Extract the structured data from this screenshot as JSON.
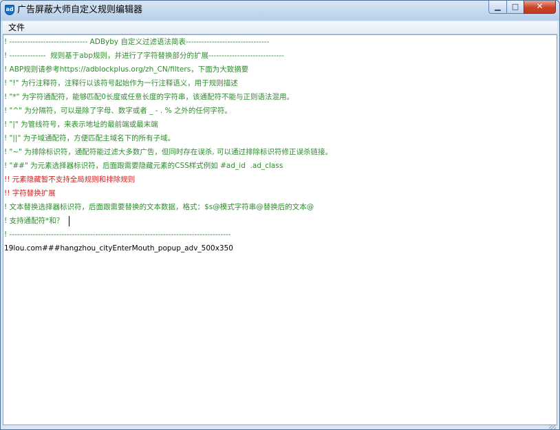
{
  "window": {
    "title": "广告屏蔽大师自定义规则编辑器",
    "icon_label": "ad"
  },
  "caption_buttons": {
    "minimize": "▁",
    "maximize": "□",
    "close": "✕"
  },
  "menu": {
    "file": "文件"
  },
  "editor": {
    "lines": [
      "! ------------------------------ ADByby 自定义过滤语法简表--------------------------------",
      "! --------------  规则基于abp规则，并进行了字符替换部分的扩展-----------------------------",
      "! ABP规则请参考https://adblockplus.org/zh_CN/filters，下面为大致摘要",
      "! \"!\" 为行注释符，注释行以该符号起始作为一行注释语义，用于规则描述",
      "! \"*\" 为字符通配符，能够匹配0长度或任意长度的字符串，该通配符不能与正则语法混用。",
      "! \"^\" 为分隔符，可以是除了字母、数字或者 _ - . % 之外的任何字符。",
      "! \"|\" 为管线符号，来表示地址的最前端或最末端",
      "! \"||\" 为子域通配符，方便匹配主域名下的所有子域。",
      "! \"~\" 为排除标识符，通配符能过滤大多数广告，但同时存在误杀, 可以通过排除标识符修正误杀链接。",
      "! \"##\" 为元素选择器标识符，后面跟需要隐藏元素的CSS样式例如 #ad_id  .ad_class",
      "!! 元素隐藏暂不支持全局规则和排除规则",
      "!! 字符替换扩展",
      "! 文本替换选择器标识符，后面跟需要替换的文本数据，格式：$s@模式字符串@替换后的文本@",
      "! 支持通配符*和？",
      "! -------------------------------------------------------------------------------------",
      "",
      "19lou.com###hangzhou_cityEnterMouth_popup_adv_500x350"
    ]
  }
}
